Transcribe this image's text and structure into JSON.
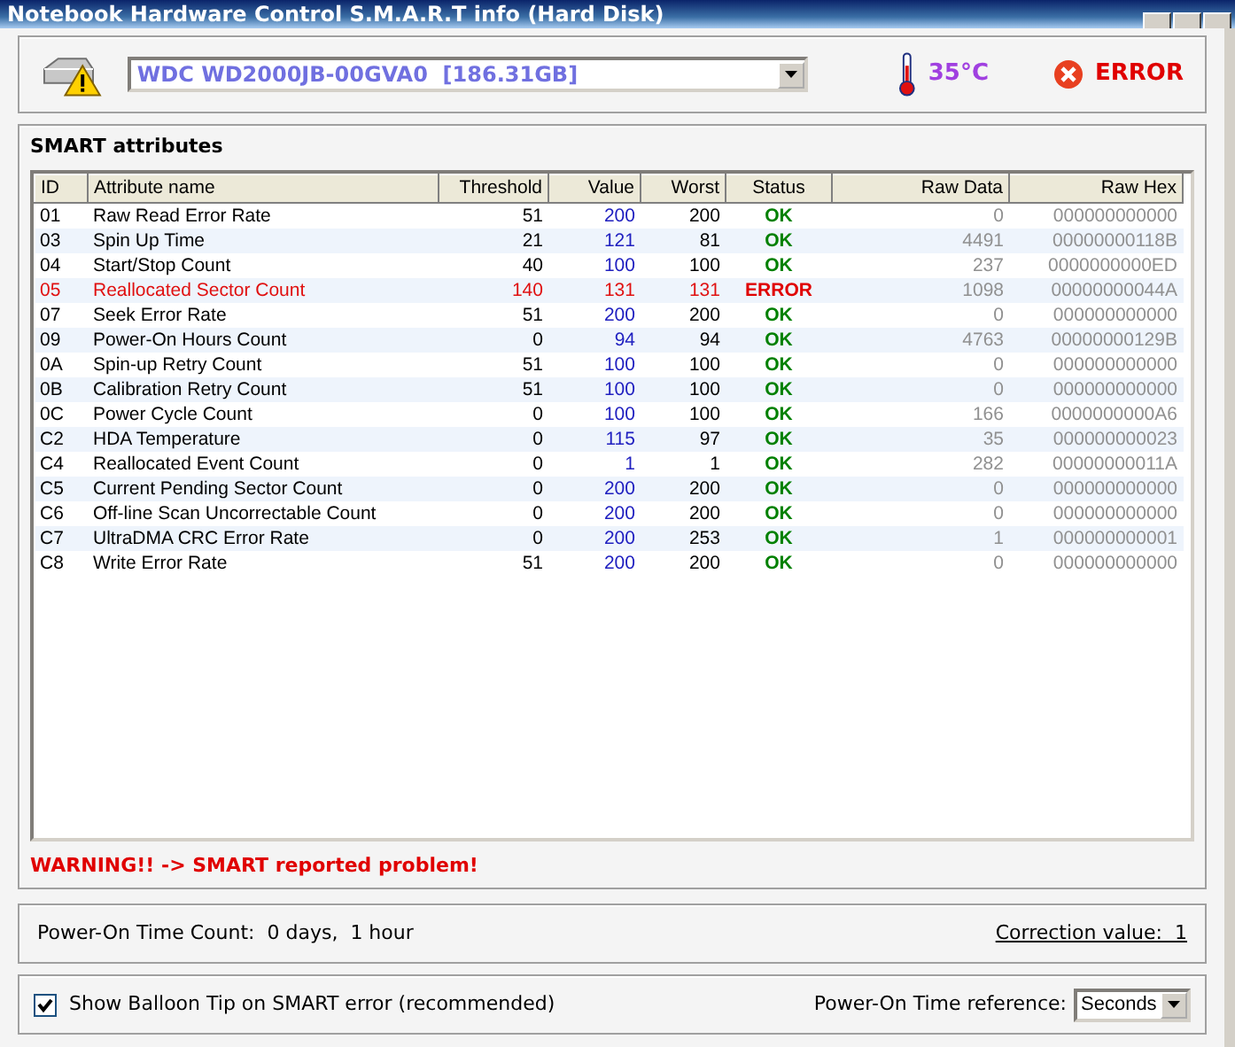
{
  "window": {
    "title": "Notebook Hardware Control  S.M.A.R.T  info (Hard Disk)"
  },
  "drive": {
    "value": "WDC WD2000JB-00GVA0  [186.31GB]"
  },
  "temperature": "35°C",
  "health": {
    "kind": "error",
    "text": "ERROR"
  },
  "smart": {
    "title": "SMART attributes",
    "columns": [
      "ID",
      "Attribute name",
      "Threshold",
      "Value",
      "Worst",
      "Status",
      "Raw Data",
      "Raw Hex"
    ],
    "rows": [
      {
        "kind": "ok",
        "cells": [
          "01",
          "Raw Read Error Rate",
          "51",
          "200",
          "200",
          "OK",
          "0",
          "000000000000"
        ]
      },
      {
        "kind": "ok",
        "cells": [
          "03",
          "Spin Up Time",
          "21",
          "121",
          "81",
          "OK",
          "4491",
          "00000000118B"
        ]
      },
      {
        "kind": "ok",
        "cells": [
          "04",
          "Start/Stop Count",
          "40",
          "100",
          "100",
          "OK",
          "237",
          "0000000000ED"
        ]
      },
      {
        "kind": "error",
        "cells": [
          "05",
          "Reallocated Sector Count",
          "140",
          "131",
          "131",
          "ERROR",
          "1098",
          "00000000044A"
        ]
      },
      {
        "kind": "ok",
        "cells": [
          "07",
          "Seek Error Rate",
          "51",
          "200",
          "200",
          "OK",
          "0",
          "000000000000"
        ]
      },
      {
        "kind": "ok",
        "cells": [
          "09",
          "Power-On Hours Count",
          "0",
          "94",
          "94",
          "OK",
          "4763",
          "00000000129B"
        ]
      },
      {
        "kind": "ok",
        "cells": [
          "0A",
          "Spin-up Retry Count",
          "51",
          "100",
          "100",
          "OK",
          "0",
          "000000000000"
        ]
      },
      {
        "kind": "ok",
        "cells": [
          "0B",
          "Calibration Retry Count",
          "51",
          "100",
          "100",
          "OK",
          "0",
          "000000000000"
        ]
      },
      {
        "kind": "ok",
        "cells": [
          "0C",
          "Power Cycle Count",
          "0",
          "100",
          "100",
          "OK",
          "166",
          "0000000000A6"
        ]
      },
      {
        "kind": "ok",
        "cells": [
          "C2",
          "HDA Temperature",
          "0",
          "115",
          "97",
          "OK",
          "35",
          "000000000023"
        ]
      },
      {
        "kind": "ok",
        "cells": [
          "C4",
          "Reallocated Event Count",
          "0",
          "1",
          "1",
          "OK",
          "282",
          "00000000011A"
        ]
      },
      {
        "kind": "ok",
        "cells": [
          "C5",
          "Current Pending Sector Count",
          "0",
          "200",
          "200",
          "OK",
          "0",
          "000000000000"
        ]
      },
      {
        "kind": "ok",
        "cells": [
          "C6",
          "Off-line Scan Uncorrectable Count",
          "0",
          "200",
          "200",
          "OK",
          "0",
          "000000000000"
        ]
      },
      {
        "kind": "ok",
        "cells": [
          "C7",
          "UltraDMA CRC Error Rate",
          "0",
          "200",
          "253",
          "OK",
          "1",
          "000000000001"
        ]
      },
      {
        "kind": "ok",
        "cells": [
          "C8",
          "Write Error Rate",
          "51",
          "200",
          "200",
          "OK",
          "0",
          "000000000000"
        ]
      }
    ],
    "warning": "WARNING!! -> SMART reported problem!"
  },
  "power_on": {
    "label": "Power-On Time Count:  0 days,  1 hour",
    "correction": "Correction value:  1"
  },
  "balloon_tip": {
    "label": "Show Balloon Tip on SMART error (recommended)",
    "checked": true
  },
  "time_reference": {
    "label": "Power-On Time reference:",
    "value": "Seconds"
  }
}
